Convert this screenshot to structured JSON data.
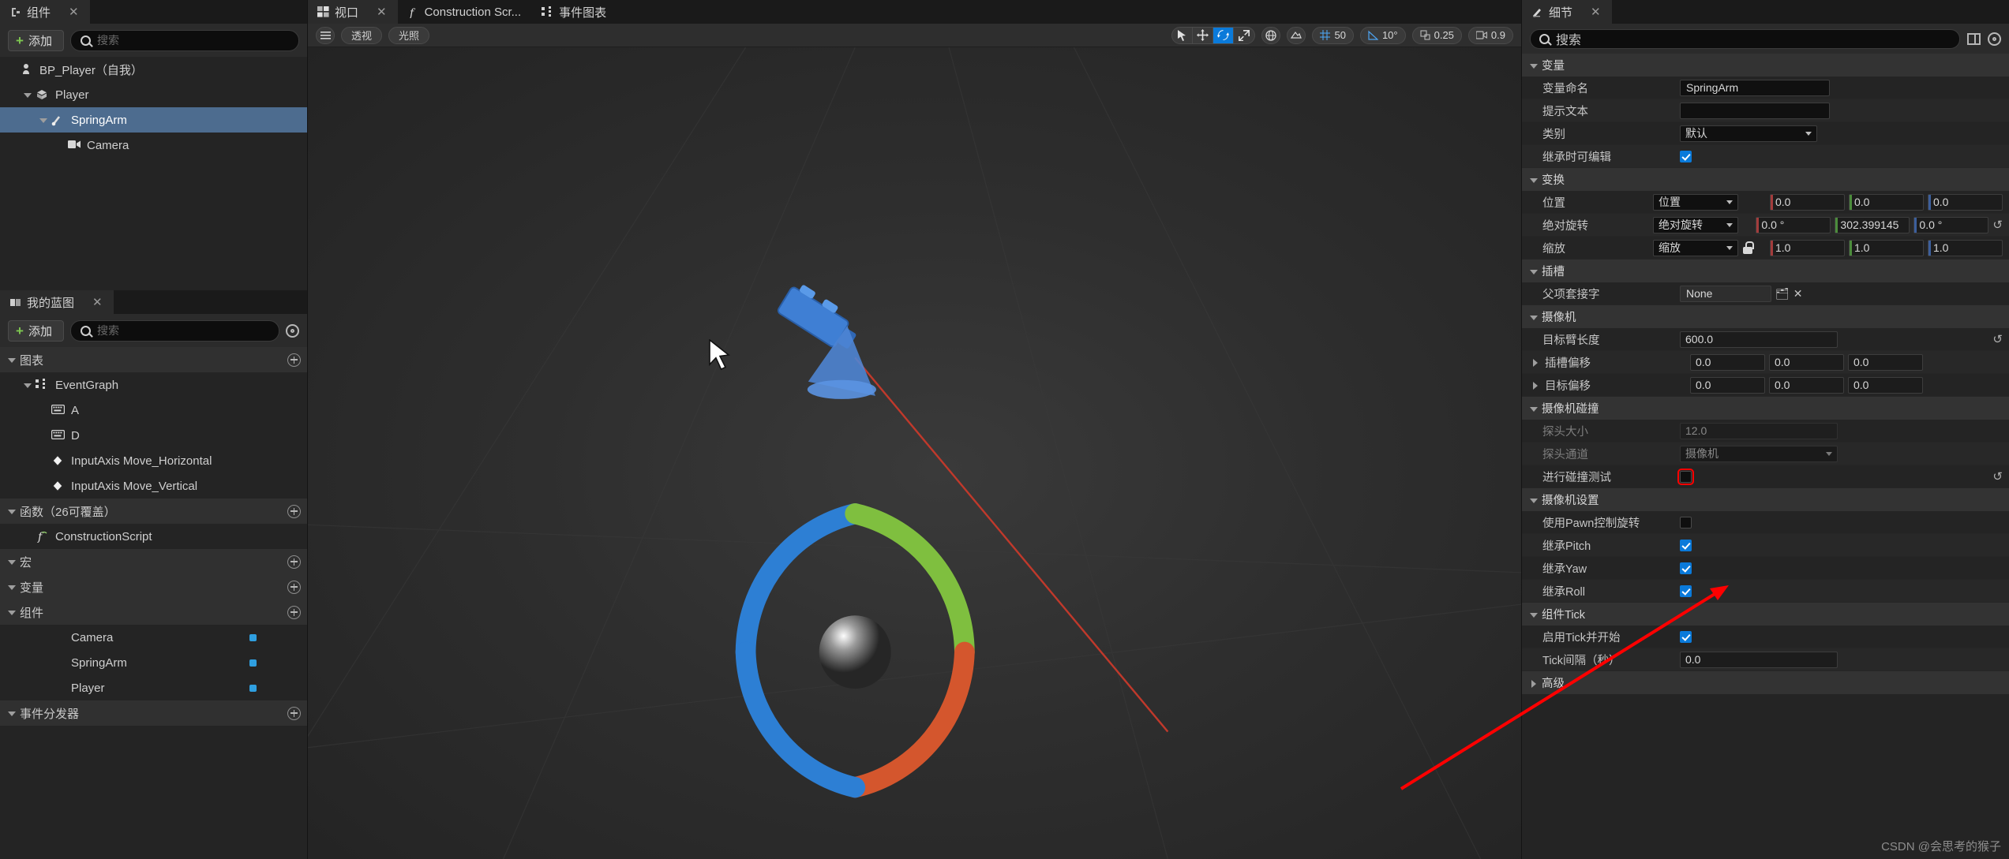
{
  "components_panel": {
    "tab_label": "组件",
    "close": "✕",
    "add_label": "添加",
    "search_placeholder": "搜索",
    "tree": [
      {
        "label": "BP_Player（自我）",
        "icon": "pawn-icon",
        "indent": 0,
        "caret": "none",
        "selected": false
      },
      {
        "label": "Player",
        "icon": "mesh-icon",
        "indent": 1,
        "caret": "down",
        "selected": false
      },
      {
        "label": "SpringArm",
        "icon": "springarm-icon",
        "indent": 2,
        "caret": "down",
        "selected": true
      },
      {
        "label": "Camera",
        "icon": "camera-icon",
        "indent": 3,
        "caret": "none",
        "selected": false
      }
    ]
  },
  "myblueprint_panel": {
    "tab_label": "我的蓝图",
    "close": "✕",
    "add_label": "添加",
    "search_placeholder": "搜索",
    "sections": [
      {
        "header": "图表",
        "items": [
          {
            "label": "EventGraph",
            "icon": "graph-icon",
            "indent": 1,
            "caret": "down"
          },
          {
            "label": "A",
            "icon": "keyboard-icon",
            "indent": 2,
            "caret": "none"
          },
          {
            "label": "D",
            "icon": "keyboard-icon",
            "indent": 2,
            "caret": "none"
          },
          {
            "label": "InputAxis Move_Horizontal",
            "icon": "event-icon",
            "indent": 2,
            "caret": "none"
          },
          {
            "label": "InputAxis Move_Vertical",
            "icon": "event-icon",
            "indent": 2,
            "caret": "none"
          }
        ]
      },
      {
        "header": "函数（26可覆盖）",
        "items": [
          {
            "label": "ConstructionScript",
            "icon": "function-icon",
            "indent": 1,
            "caret": "none"
          }
        ]
      },
      {
        "header": "宏",
        "items": []
      },
      {
        "header": "变量",
        "items": []
      },
      {
        "header": "组件",
        "items": [
          {
            "label": "Camera",
            "icon": "variable-icon",
            "indent": 2,
            "caret": "none",
            "pin": true
          },
          {
            "label": "SpringArm",
            "icon": "variable-icon",
            "indent": 2,
            "caret": "none",
            "pin": true
          },
          {
            "label": "Player",
            "icon": "variable-icon",
            "indent": 2,
            "caret": "none",
            "pin": true
          }
        ]
      },
      {
        "header": "事件分发器",
        "items": []
      }
    ]
  },
  "editor_tabs": [
    {
      "label": "视口",
      "icon": "viewport-icon",
      "active": true,
      "close": "✕"
    },
    {
      "label": "Construction Scr...",
      "icon": "function-icon",
      "active": false,
      "close": ""
    },
    {
      "label": "事件图表",
      "icon": "graph-icon",
      "active": false,
      "close": ""
    }
  ],
  "viewport_toolbar": {
    "menu_icon": "hamburger-icon",
    "perspective_label": "透视",
    "lit_label": "光照",
    "gizmo": [
      {
        "name": "select-tool",
        "glyph": "➤",
        "active": false
      },
      {
        "name": "move-tool",
        "glyph": "✥",
        "active": false
      },
      {
        "name": "rotate-tool",
        "glyph": "⟳",
        "active": true
      },
      {
        "name": "scale-tool",
        "glyph": "⤢",
        "active": false
      }
    ],
    "world_space_icon": "globe-icon",
    "surface_snap_icon": "surface-snap-icon",
    "grid_snap": {
      "icon": "grid-icon",
      "value": "50"
    },
    "angle_snap": {
      "icon": "angle-icon",
      "value": "10°"
    },
    "scale_snap": {
      "icon": "scale-snap-icon",
      "value": "0.25"
    },
    "camera_speed": {
      "icon": "camera-speed-icon",
      "value": "0.9"
    }
  },
  "details_panel": {
    "tab_label": "细节",
    "close": "✕",
    "search_placeholder": "搜索",
    "column_icon": "columns-icon",
    "settings_icon": "gear-icon",
    "sections": [
      {
        "name": "变量",
        "rows": [
          {
            "label": "变量命名",
            "type": "text",
            "value": "SpringArm"
          },
          {
            "label": "提示文本",
            "type": "text",
            "value": ""
          },
          {
            "label": "类别",
            "type": "combo",
            "value": "默认"
          },
          {
            "label": "继承时可编辑",
            "type": "checkbox",
            "value": true
          }
        ]
      },
      {
        "name": "变换",
        "rows": [
          {
            "label": "位置",
            "type": "vector-combo",
            "combo": "位置",
            "x": "0.0",
            "y": "0.0",
            "z": "0.0",
            "reset": false
          },
          {
            "label": "绝对旋转",
            "type": "vector-combo",
            "combo": "绝对旋转",
            "x": "0.0 °",
            "y": "302.399145",
            "z": "0.0 °",
            "reset": true
          },
          {
            "label": "缩放",
            "type": "vector-combo",
            "combo": "缩放",
            "lock": true,
            "x": "1.0",
            "y": "1.0",
            "z": "1.0",
            "reset": false
          }
        ]
      },
      {
        "name": "插槽",
        "rows": [
          {
            "label": "父项套接字",
            "type": "socket",
            "value": "None",
            "browse_icon": "browse-icon",
            "clear_icon": "close-icon"
          }
        ]
      },
      {
        "name": "摄像机",
        "rows": [
          {
            "label": "目标臂长度",
            "type": "number-wide",
            "value": "600.0",
            "reset": true
          },
          {
            "label": "插槽偏移",
            "type": "vector3",
            "expand": true,
            "x": "0.0",
            "y": "0.0",
            "z": "0.0"
          },
          {
            "label": "目标偏移",
            "type": "vector3",
            "expand": true,
            "x": "0.0",
            "y": "0.0",
            "z": "0.0"
          }
        ]
      },
      {
        "name": "摄像机碰撞",
        "rows": [
          {
            "label": "探头大小",
            "type": "number-wide",
            "value": "12.0",
            "disabled": true
          },
          {
            "label": "探头通道",
            "type": "combo-wide",
            "value": "摄像机",
            "disabled": true
          },
          {
            "label": "进行碰撞测试",
            "type": "checkbox",
            "value": false,
            "reset": true,
            "highlight": true
          }
        ]
      },
      {
        "name": "摄像机设置",
        "rows": [
          {
            "label": "使用Pawn控制旋转",
            "type": "checkbox",
            "value": false
          },
          {
            "label": "继承Pitch",
            "type": "checkbox",
            "value": true
          },
          {
            "label": "继承Yaw",
            "type": "checkbox",
            "value": true
          },
          {
            "label": "继承Roll",
            "type": "checkbox",
            "value": true
          }
        ]
      },
      {
        "name": "组件Tick",
        "rows": [
          {
            "label": "启用Tick并开始",
            "type": "checkbox",
            "value": true
          },
          {
            "label": "Tick间隔（秒）",
            "type": "number-wide",
            "value": "0.0"
          }
        ]
      },
      {
        "name": "高级",
        "collapsed": true,
        "rows": []
      }
    ]
  },
  "annotation": {
    "arrow_color": "#ff0000",
    "target": "进行碰撞测试"
  },
  "watermark": "CSDN @会思考的猴子"
}
